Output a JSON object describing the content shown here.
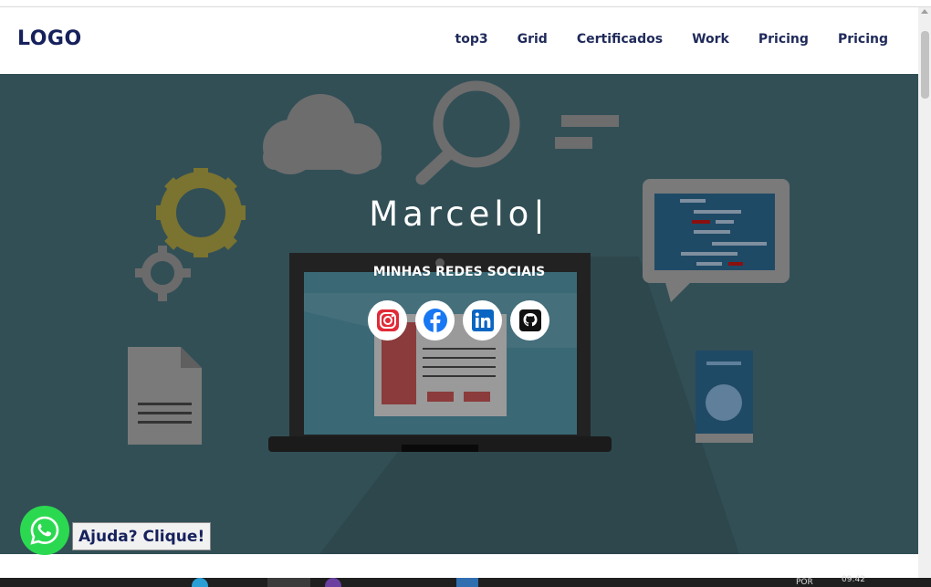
{
  "header": {
    "logo": "LOGO",
    "nav": [
      "top3",
      "Grid",
      "Certificados",
      "Work",
      "Pricing",
      "Pricing"
    ]
  },
  "hero": {
    "title": "Marcelo|",
    "subtitle": "MINHAS REDES SOCIAIS",
    "socials": [
      {
        "name": "instagram",
        "icon": "instagram-icon",
        "color": "#e1306c"
      },
      {
        "name": "facebook",
        "icon": "facebook-icon",
        "color": "#1877f2"
      },
      {
        "name": "linkedin",
        "icon": "linkedin-icon",
        "color": "#0a66c2"
      },
      {
        "name": "github",
        "icon": "github-icon",
        "color": "#111111"
      }
    ],
    "background_color": "#324f56"
  },
  "whatsapp": {
    "icon": "whatsapp-icon",
    "color": "#2bd951",
    "label": "Ajuda? Clique!"
  },
  "taskbar": {
    "lang": "POR",
    "time": "09:42"
  }
}
